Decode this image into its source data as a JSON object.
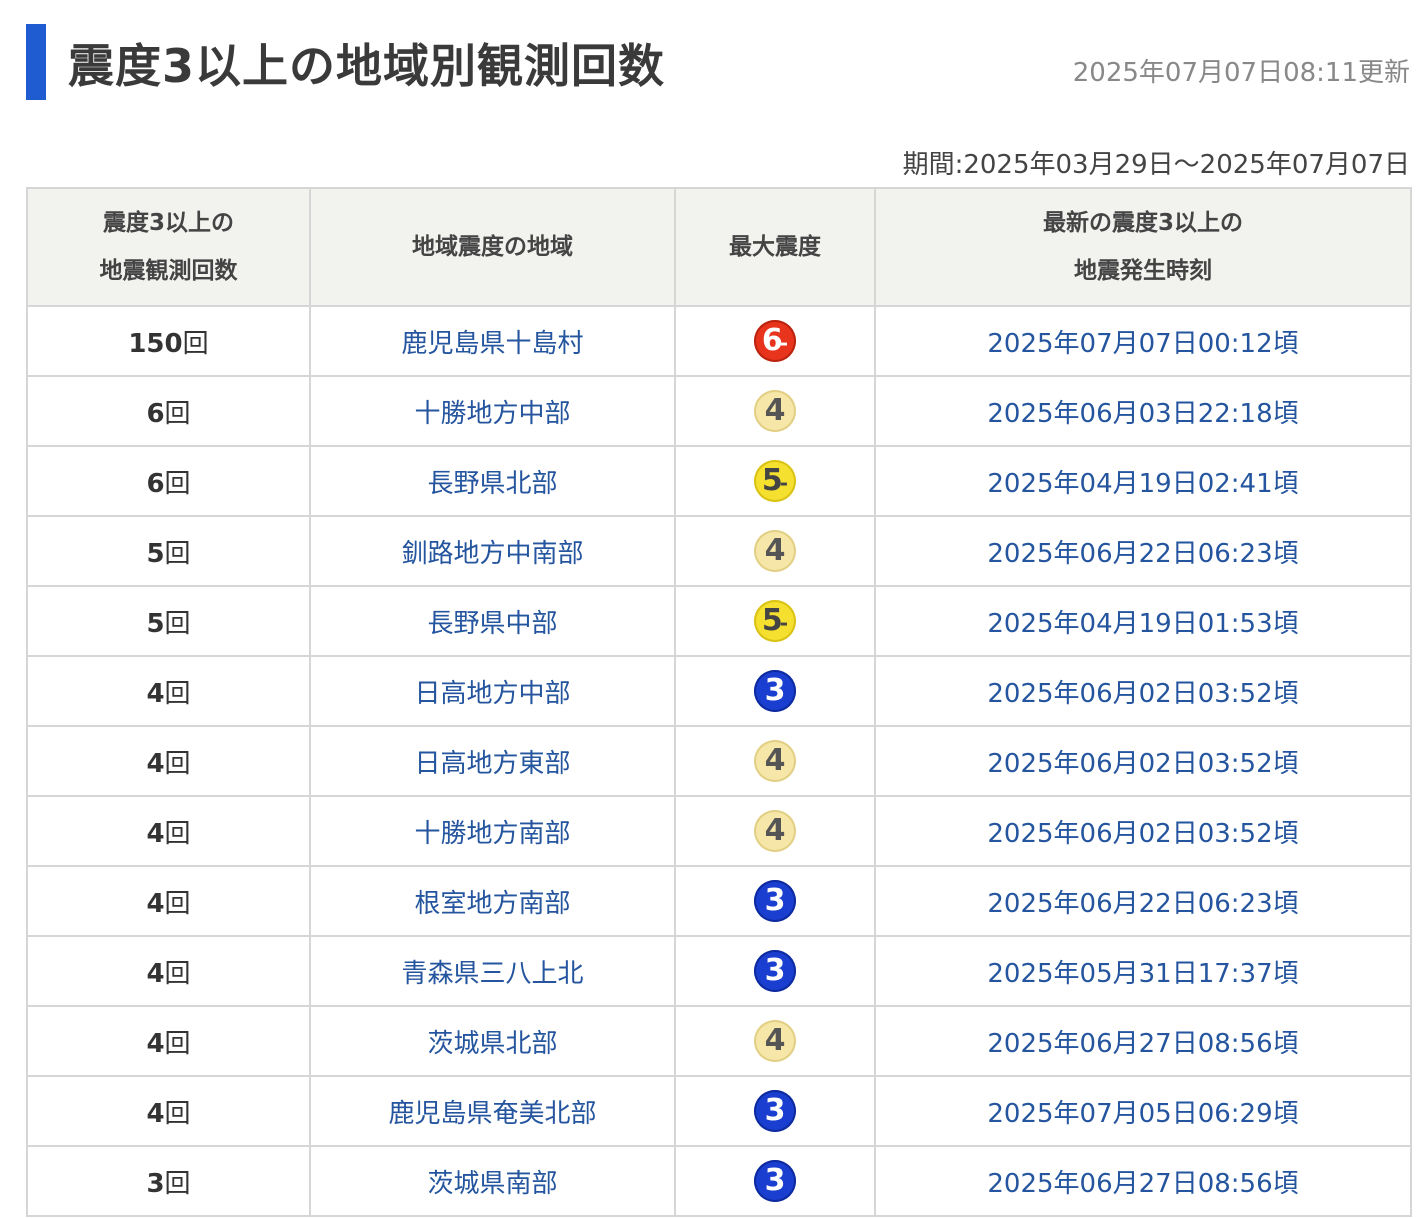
{
  "header": {
    "title": "震度3以上の地域別観測回数",
    "updated": "2025年07月07日08:11更新"
  },
  "period": "期間:2025年03月29日～2025年07月07日",
  "table": {
    "columns": [
      {
        "line1": "震度3以上の",
        "line2": "地震観測回数"
      },
      {
        "line1": "地域震度の地域",
        "line2": ""
      },
      {
        "line1": "最大震度",
        "line2": ""
      },
      {
        "line1": "最新の震度3以上の",
        "line2": "地震発生時刻"
      }
    ],
    "count_unit": "回",
    "rows": [
      {
        "count": "150",
        "region": "鹿児島県十島村",
        "intensity": "6",
        "modifier": "-",
        "time": "2025年07月07日00:12頃"
      },
      {
        "count": "6",
        "region": "十勝地方中部",
        "intensity": "4",
        "modifier": "",
        "time": "2025年06月03日22:18頃"
      },
      {
        "count": "6",
        "region": "長野県北部",
        "intensity": "5",
        "modifier": "-",
        "time": "2025年04月19日02:41頃"
      },
      {
        "count": "5",
        "region": "釧路地方中南部",
        "intensity": "4",
        "modifier": "",
        "time": "2025年06月22日06:23頃"
      },
      {
        "count": "5",
        "region": "長野県中部",
        "intensity": "5",
        "modifier": "-",
        "time": "2025年04月19日01:53頃"
      },
      {
        "count": "4",
        "region": "日高地方中部",
        "intensity": "3",
        "modifier": "",
        "time": "2025年06月02日03:52頃"
      },
      {
        "count": "4",
        "region": "日高地方東部",
        "intensity": "4",
        "modifier": "",
        "time": "2025年06月02日03:52頃"
      },
      {
        "count": "4",
        "region": "十勝地方南部",
        "intensity": "4",
        "modifier": "",
        "time": "2025年06月02日03:52頃"
      },
      {
        "count": "4",
        "region": "根室地方南部",
        "intensity": "3",
        "modifier": "",
        "time": "2025年06月22日06:23頃"
      },
      {
        "count": "4",
        "region": "青森県三八上北",
        "intensity": "3",
        "modifier": "",
        "time": "2025年05月31日17:37頃"
      },
      {
        "count": "4",
        "region": "茨城県北部",
        "intensity": "4",
        "modifier": "",
        "time": "2025年06月27日08:56頃"
      },
      {
        "count": "4",
        "region": "鹿児島県奄美北部",
        "intensity": "3",
        "modifier": "",
        "time": "2025年07月05日06:29頃"
      },
      {
        "count": "3",
        "region": "茨城県南部",
        "intensity": "3",
        "modifier": "",
        "time": "2025年06月27日08:56頃"
      }
    ]
  },
  "intensity_colors": {
    "3": {
      "bg": "#1a3fd0",
      "fg": "#ffffff",
      "ring": "#0d2a9e"
    },
    "4": {
      "bg": "#f6e7a8",
      "fg": "#555555",
      "ring": "#e2cf86"
    },
    "5": {
      "bg": "#f5e030",
      "fg": "#444444",
      "ring": "#d9c215"
    },
    "6": {
      "bg": "#e8341c",
      "fg": "#ffffff",
      "ring": "#b9230f"
    }
  },
  "colors": {
    "accent": "#1f5bd1",
    "link": "#24559e",
    "header_bg": "#f2f2ef",
    "border": "#d6d6d6"
  }
}
